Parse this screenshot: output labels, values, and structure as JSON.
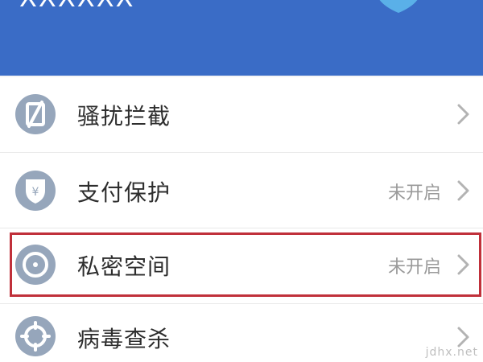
{
  "header": {
    "title": "XXXXXX",
    "bg_color": "#3a6cc6"
  },
  "menu": {
    "items": [
      {
        "label": "骚扰拦截",
        "status": "",
        "icon": "phone-block-icon"
      },
      {
        "label": "支付保护",
        "status": "未开启",
        "icon": "payment-shield-icon"
      },
      {
        "label": "私密空间",
        "status": "未开启",
        "icon": "private-space-icon"
      },
      {
        "label": "病毒查杀",
        "status": "",
        "icon": "virus-scan-icon"
      }
    ]
  },
  "highlight_color": "#c0303a",
  "watermark": "jdhx.net"
}
